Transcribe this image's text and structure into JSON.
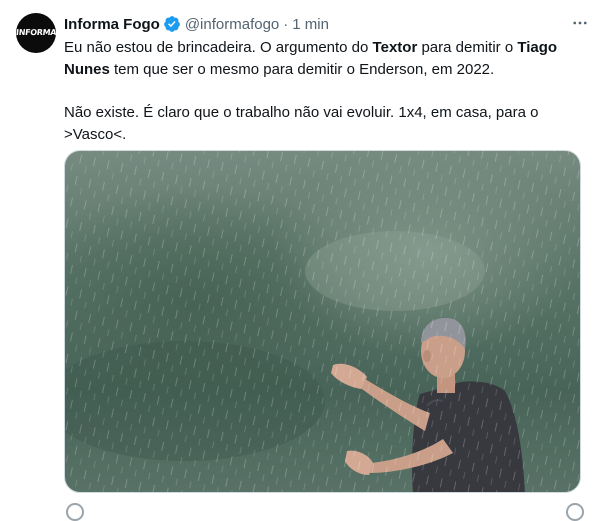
{
  "tweet": {
    "avatar_label": "INFORMA",
    "author_name": "Informa Fogo",
    "handle": "@informafogo",
    "separator": "·",
    "time": "1 min",
    "more_icon": "more-horizontal-icon",
    "verified_icon": "verified-badge-icon",
    "text": {
      "p1_a": "Eu não estou de brincadeira. O argumento do ",
      "p1_b": "Textor",
      "p1_c": " para demitir o ",
      "p1_d": "Tiago Nunes",
      "p1_e": " tem que ser o mesmo para demitir o Enderson, em 2022.",
      "p2": "Não existe. É claro que o trabalho não vai evoluir. 1x4, em casa, para o >Vasco<."
    }
  },
  "colors": {
    "text_primary": "#0f1419",
    "text_secondary": "#536471",
    "verified_blue": "#1d9bf0",
    "border": "#cfd9de"
  }
}
